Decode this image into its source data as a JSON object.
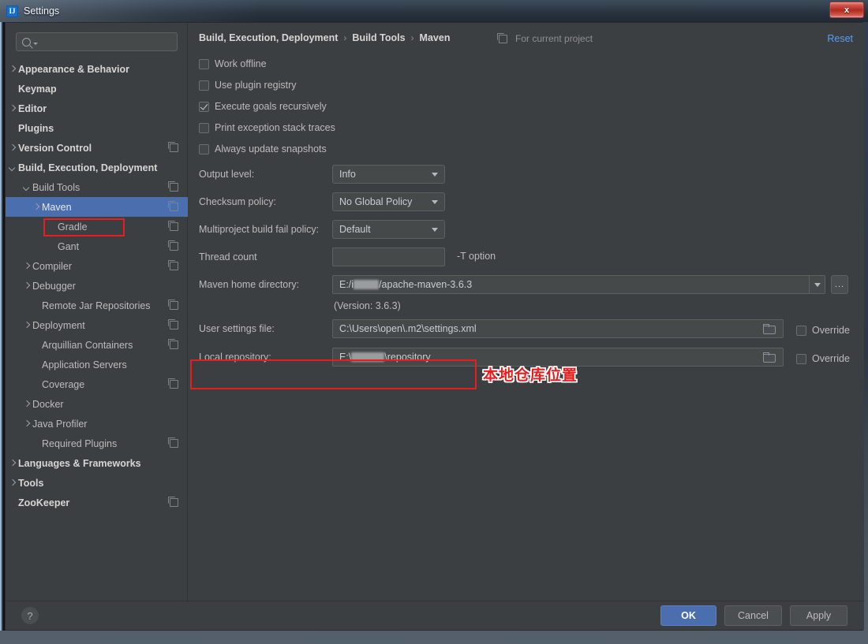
{
  "window": {
    "title": "Settings",
    "app_icon": "intellij-idea-icon",
    "close_label": "x"
  },
  "sidebar": {
    "search": {
      "placeholder": "",
      "value": "",
      "icon": "search-icon"
    },
    "items": [
      {
        "label": "Appearance & Behavior",
        "indent": 0,
        "arrow": "right",
        "bold": true,
        "copy": false,
        "selected": false
      },
      {
        "label": "Keymap",
        "indent": 0,
        "arrow": "none",
        "bold": true,
        "copy": false,
        "selected": false
      },
      {
        "label": "Editor",
        "indent": 0,
        "arrow": "right",
        "bold": true,
        "copy": false,
        "selected": false
      },
      {
        "label": "Plugins",
        "indent": 0,
        "arrow": "none",
        "bold": true,
        "copy": false,
        "selected": false
      },
      {
        "label": "Version Control",
        "indent": 0,
        "arrow": "right",
        "bold": true,
        "copy": true,
        "selected": false
      },
      {
        "label": "Build, Execution, Deployment",
        "indent": 0,
        "arrow": "down",
        "bold": true,
        "copy": false,
        "selected": false
      },
      {
        "label": "Build Tools",
        "indent": 1,
        "arrow": "down",
        "bold": false,
        "copy": true,
        "selected": false
      },
      {
        "label": "Maven",
        "indent": 2,
        "arrow": "right",
        "bold": false,
        "copy": true,
        "selected": true
      },
      {
        "label": "Gradle",
        "indent": 3,
        "arrow": "none",
        "bold": false,
        "copy": true,
        "selected": false
      },
      {
        "label": "Gant",
        "indent": 3,
        "arrow": "none",
        "bold": false,
        "copy": true,
        "selected": false
      },
      {
        "label": "Compiler",
        "indent": 1,
        "arrow": "right",
        "bold": false,
        "copy": true,
        "selected": false
      },
      {
        "label": "Debugger",
        "indent": 1,
        "arrow": "right",
        "bold": false,
        "copy": false,
        "selected": false
      },
      {
        "label": "Remote Jar Repositories",
        "indent": 2,
        "arrow": "none",
        "bold": false,
        "copy": true,
        "selected": false
      },
      {
        "label": "Deployment",
        "indent": 1,
        "arrow": "right",
        "bold": false,
        "copy": true,
        "selected": false
      },
      {
        "label": "Arquillian Containers",
        "indent": 2,
        "arrow": "none",
        "bold": false,
        "copy": true,
        "selected": false
      },
      {
        "label": "Application Servers",
        "indent": 2,
        "arrow": "none",
        "bold": false,
        "copy": false,
        "selected": false
      },
      {
        "label": "Coverage",
        "indent": 2,
        "arrow": "none",
        "bold": false,
        "copy": true,
        "selected": false
      },
      {
        "label": "Docker",
        "indent": 1,
        "arrow": "right",
        "bold": false,
        "copy": false,
        "selected": false
      },
      {
        "label": "Java Profiler",
        "indent": 1,
        "arrow": "right",
        "bold": false,
        "copy": false,
        "selected": false
      },
      {
        "label": "Required Plugins",
        "indent": 2,
        "arrow": "none",
        "bold": false,
        "copy": true,
        "selected": false
      },
      {
        "label": "Languages & Frameworks",
        "indent": 0,
        "arrow": "right",
        "bold": true,
        "copy": false,
        "selected": false
      },
      {
        "label": "Tools",
        "indent": 0,
        "arrow": "right",
        "bold": true,
        "copy": false,
        "selected": false
      },
      {
        "label": "ZooKeeper",
        "indent": 0,
        "arrow": "none",
        "bold": true,
        "copy": true,
        "selected": false
      }
    ]
  },
  "header": {
    "breadcrumb": [
      "Build, Execution, Deployment",
      "Build Tools",
      "Maven"
    ],
    "separator": "›",
    "scope_label": "For current project",
    "scope_icon": "copy-icon",
    "reset_label": "Reset"
  },
  "main": {
    "checkboxes": [
      {
        "label": "Work offline",
        "checked": false
      },
      {
        "label": "Use plugin registry",
        "checked": false
      },
      {
        "label": "Execute goals recursively",
        "checked": true
      },
      {
        "label": "Print exception stack traces",
        "checked": false
      },
      {
        "label": "Always update snapshots",
        "checked": false
      }
    ],
    "output_level": {
      "label": "Output level:",
      "value": "Info"
    },
    "checksum_policy": {
      "label": "Checksum policy:",
      "value": "No Global Policy"
    },
    "multiproject_policy": {
      "label": "Multiproject build fail policy:",
      "value": "Default"
    },
    "thread_count": {
      "label": "Thread count",
      "value": "",
      "hint": "-T option"
    },
    "maven_home": {
      "label": "Maven home directory:",
      "value_prefix": "E:/i",
      "value_suffix": "/apache-maven-3.6.3",
      "version_note": "(Version: 3.6.3)",
      "browse_label": "..."
    },
    "user_settings": {
      "label": "User settings file:",
      "value": "C:\\Users\\open\\.m2\\settings.xml",
      "override_label": "Override",
      "override_checked": false
    },
    "local_repository": {
      "label": "Local repository:",
      "value_prefix": "E:\\",
      "value_suffix": "\\repository",
      "override_label": "Override",
      "override_checked": false
    }
  },
  "annotations": {
    "chinese_note": "本地仓库位置",
    "highlight_color": "#e81d1d"
  },
  "footer": {
    "help_label": "?",
    "ok_label": "OK",
    "cancel_label": "Cancel",
    "apply_label": "Apply"
  }
}
